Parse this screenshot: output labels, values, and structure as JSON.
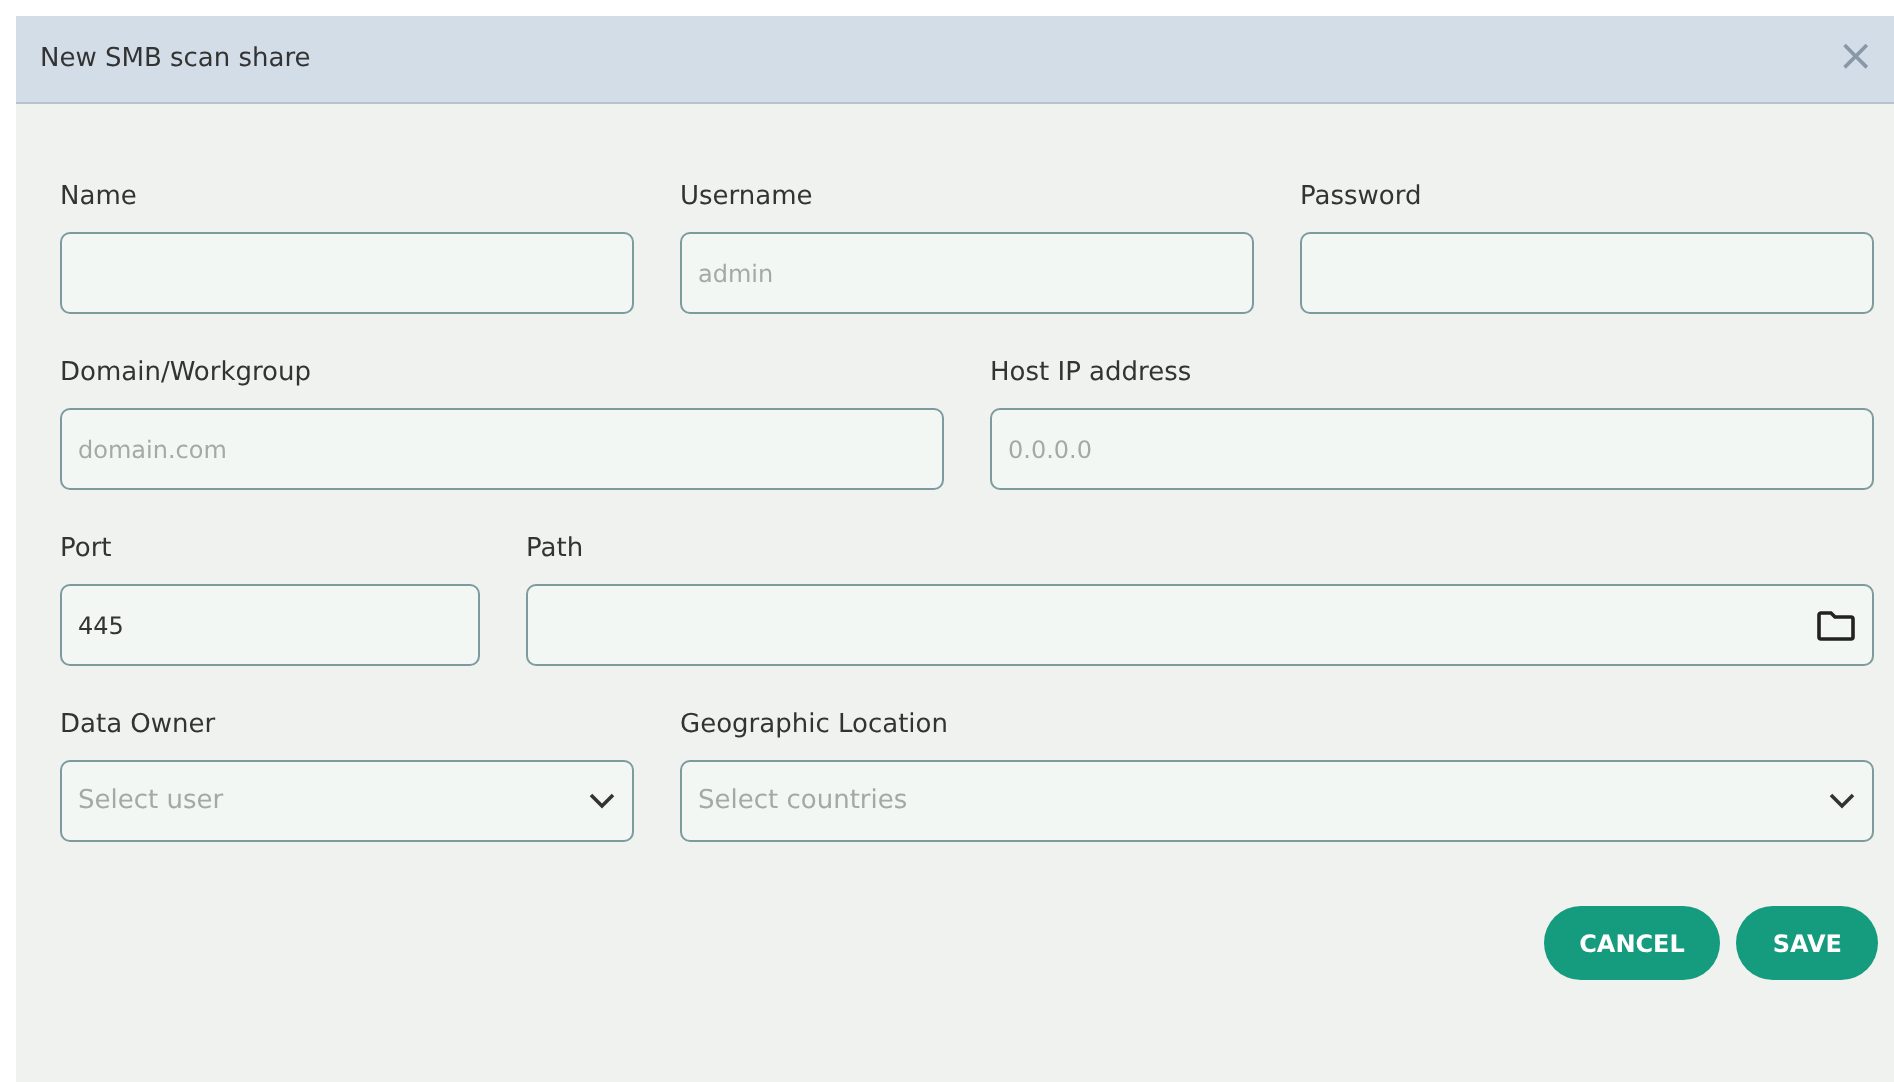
{
  "dialog": {
    "title": "New SMB scan share",
    "close": "×"
  },
  "field_rows": [
    [
      {
        "label": "Name",
        "kind": "text"
      },
      {
        "label": "Username",
        "kind": "text",
        "placeholder": "admin"
      },
      {
        "label": "Password",
        "kind": "password"
      }
    ],
    [
      {
        "label": "Domain/Workgroup",
        "kind": "text",
        "placeholder": "domain.com"
      },
      {
        "label": "Host IP address",
        "kind": "text",
        "placeholder": "0.0.0.0"
      }
    ],
    [
      {
        "label": "Port",
        "kind": "text",
        "value": "445"
      },
      {
        "label": "Path",
        "kind": "folder"
      }
    ],
    [
      {
        "label": "Data Owner",
        "kind": "select",
        "placeholder": "Select user"
      },
      {
        "label": "Geographic Location",
        "kind": "select",
        "placeholder": "Select countries"
      }
    ]
  ],
  "buttons": [
    "CANCEL",
    "SAVE"
  ]
}
